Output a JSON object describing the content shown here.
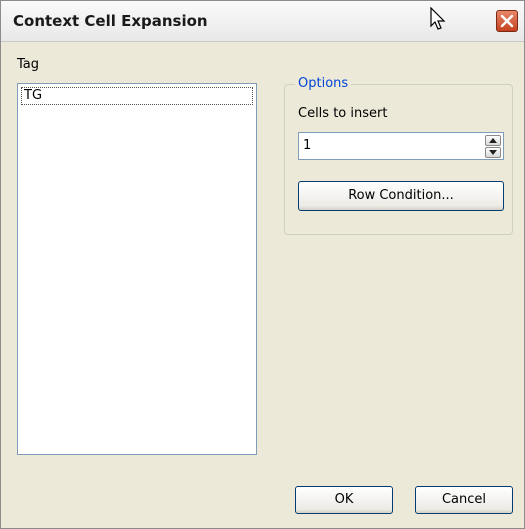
{
  "window": {
    "title": "Context Cell Expansion"
  },
  "tag": {
    "label": "Tag",
    "items": [
      "TG"
    ]
  },
  "options": {
    "legend": "Options",
    "cells_label": "Cells to insert",
    "cells_value": "1",
    "row_condition_label": "Row Condition..."
  },
  "footer": {
    "ok_label": "OK",
    "cancel_label": "Cancel"
  },
  "icons": {
    "close": "close-icon",
    "cursor": "mouse-cursor-icon",
    "spin_up": "chevron-up-icon",
    "spin_down": "chevron-down-icon"
  },
  "colors": {
    "legend": "#0046d5",
    "close_button": "#c4411f",
    "input_border": "#7f9db9",
    "dialog_bg": "#ece9d8"
  }
}
